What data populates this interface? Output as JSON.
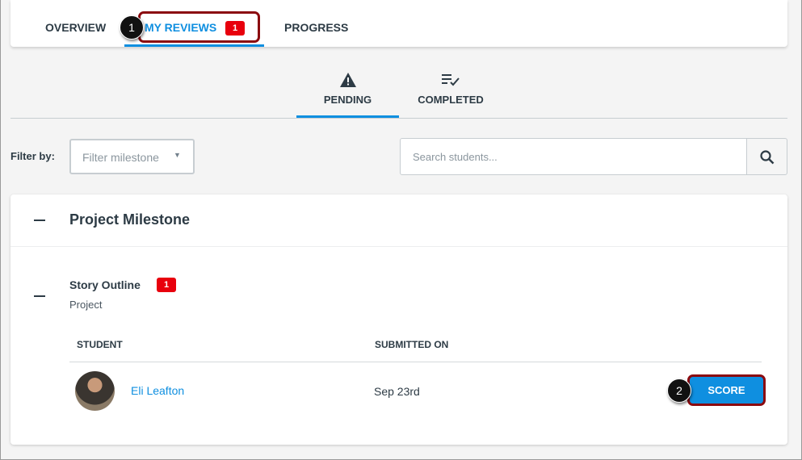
{
  "tabs": [
    {
      "label": "OVERVIEW"
    },
    {
      "label": "MY REVIEWS",
      "badge": "1"
    },
    {
      "label": "PROGRESS"
    }
  ],
  "subtabs": [
    {
      "label": "PENDING",
      "icon": "warning-icon"
    },
    {
      "label": "COMPLETED",
      "icon": "list-check-icon"
    }
  ],
  "filter": {
    "label": "Filter by:",
    "placeholder": "Filter milestone"
  },
  "search": {
    "placeholder": "Search students..."
  },
  "milestone": {
    "title": "Project Milestone",
    "assignment": {
      "title": "Story Outline",
      "badge": "1",
      "type": "Project"
    }
  },
  "table": {
    "headers": [
      "STUDENT",
      "SUBMITTED ON"
    ],
    "rows": [
      {
        "student": "Eli Leafton",
        "submitted": "Sep 23rd",
        "action": "SCORE"
      }
    ]
  },
  "callouts": [
    "1",
    "2"
  ],
  "colors": {
    "accent": "#0f8fe0",
    "badge": "#e8000d",
    "highlight": "#8b0a0f"
  }
}
